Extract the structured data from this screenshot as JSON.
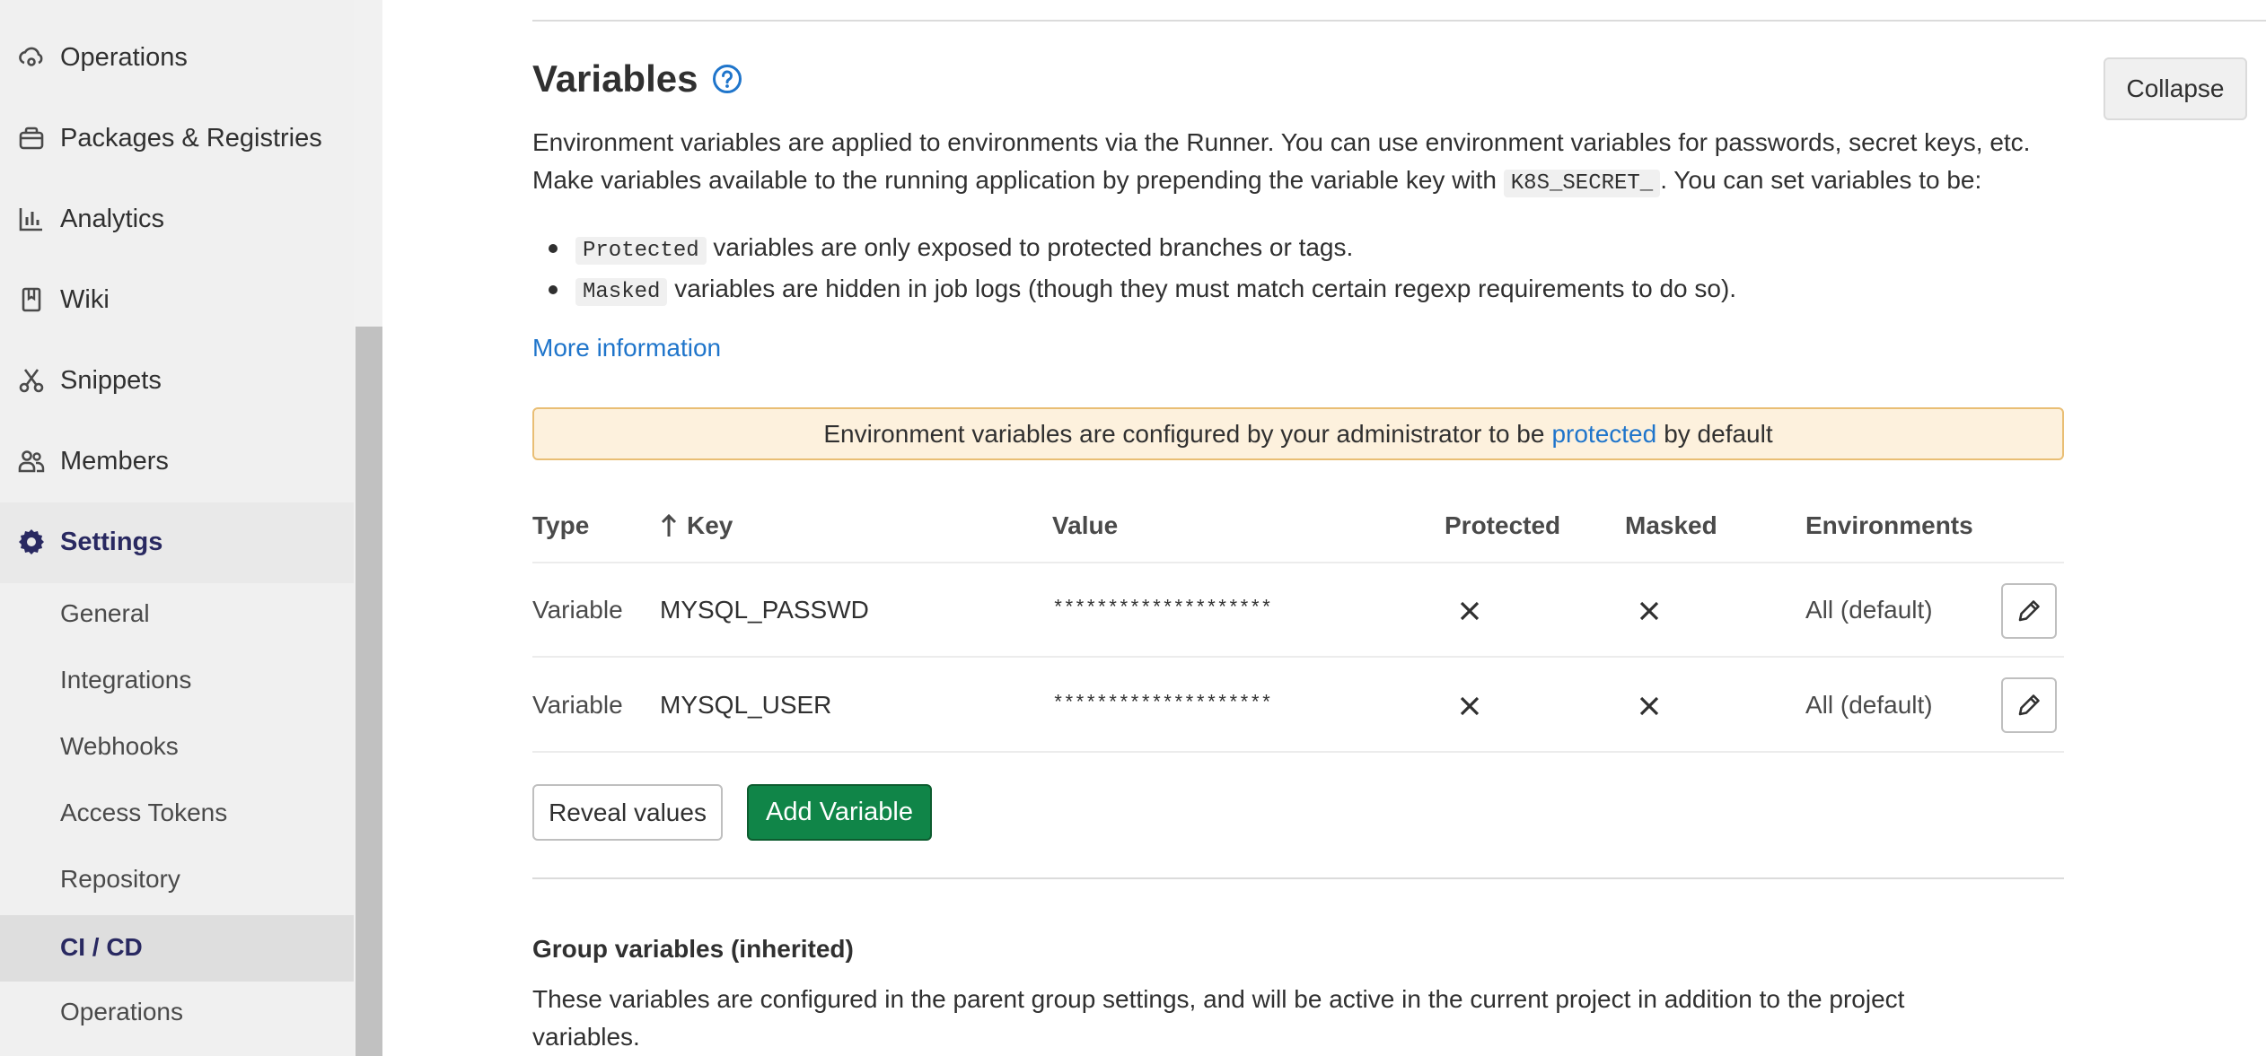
{
  "sidebar": {
    "items": [
      {
        "label": "Operations",
        "icon": "cloud-gear-icon"
      },
      {
        "label": "Packages & Registries",
        "icon": "package-icon"
      },
      {
        "label": "Analytics",
        "icon": "chart-icon"
      },
      {
        "label": "Wiki",
        "icon": "book-icon"
      },
      {
        "label": "Snippets",
        "icon": "scissors-icon"
      },
      {
        "label": "Members",
        "icon": "users-icon"
      },
      {
        "label": "Settings",
        "icon": "gear-icon"
      }
    ],
    "sub_items": [
      {
        "label": "General"
      },
      {
        "label": "Integrations"
      },
      {
        "label": "Webhooks"
      },
      {
        "label": "Access Tokens"
      },
      {
        "label": "Repository"
      },
      {
        "label": "CI / CD",
        "active": true
      },
      {
        "label": "Operations"
      }
    ]
  },
  "main": {
    "title": "Variables",
    "collapse_label": "Collapse",
    "desc_line1": "Environment variables are applied to environments via the Runner. You can use environment variables for passwords, secret keys, etc.",
    "desc_line2_pre": "Make variables available to the running application by prepending the variable key with",
    "desc_code": "K8S_SECRET_",
    "desc_line2_post": ". You can set variables to be:",
    "bullets": [
      {
        "code": "Protected",
        "text": " variables are only exposed to protected branches or tags."
      },
      {
        "code": "Masked",
        "text": " variables are hidden in job logs (though they must match certain regexp requirements to do so)."
      }
    ],
    "more_info": "More information",
    "alert_pre": "Environment variables are configured by your administrator to be",
    "alert_link": "protected",
    "alert_post": "by default"
  },
  "table": {
    "headers": {
      "type": "Type",
      "key": "Key",
      "value": "Value",
      "protected": "Protected",
      "masked": "Masked",
      "environments": "Environments"
    },
    "rows": [
      {
        "type": "Variable",
        "key": "MYSQL_PASSWD",
        "value": "********************",
        "environments": "All (default)"
      },
      {
        "type": "Variable",
        "key": "MYSQL_USER",
        "value": "********************",
        "environments": "All (default)"
      }
    ]
  },
  "actions": {
    "reveal": "Reveal values",
    "add": "Add Variable"
  },
  "group": {
    "title": "Group variables (inherited)",
    "desc": "These variables are configured in the parent group settings, and will be active in the current project in addition to the project variables."
  },
  "colors": {
    "accent": "#1f75cb",
    "primary_button": "#108548",
    "alert_bg": "#fdf1dd",
    "alert_border": "#e9be74",
    "active_nav_text": "#292961"
  }
}
